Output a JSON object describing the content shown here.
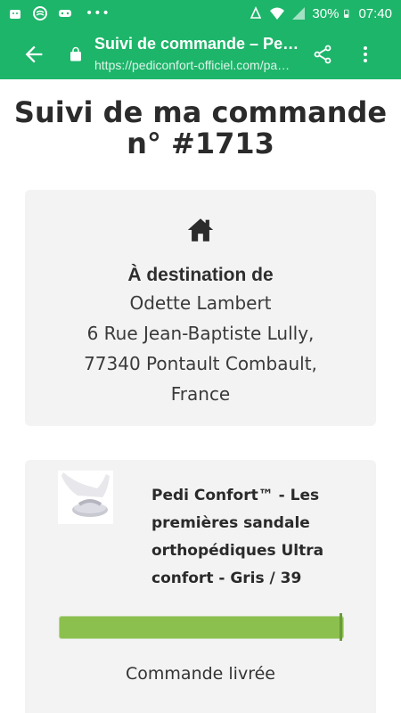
{
  "status_bar": {
    "battery": "30%",
    "time": "07:40"
  },
  "browser": {
    "title": "Suivi de commande – Pedi…",
    "url": "https://pediconfort-officiel.com/pa…"
  },
  "page": {
    "heading": "Suivi de ma commande n° #1713"
  },
  "address": {
    "label": "À destination de",
    "name": "Odette Lambert",
    "street": "6 Rue Jean-Baptiste Lully,",
    "city": "77340 Pontault Combault,",
    "country": "France"
  },
  "product": {
    "name": "Pedi Confort™ - Les premières sandale orthopédiques Ultra confort - Gris / 39",
    "progress": 1.0,
    "status": "Commande livrée",
    "progress_color": "#8cc04e"
  },
  "colors": {
    "accent": "#1db56a"
  }
}
